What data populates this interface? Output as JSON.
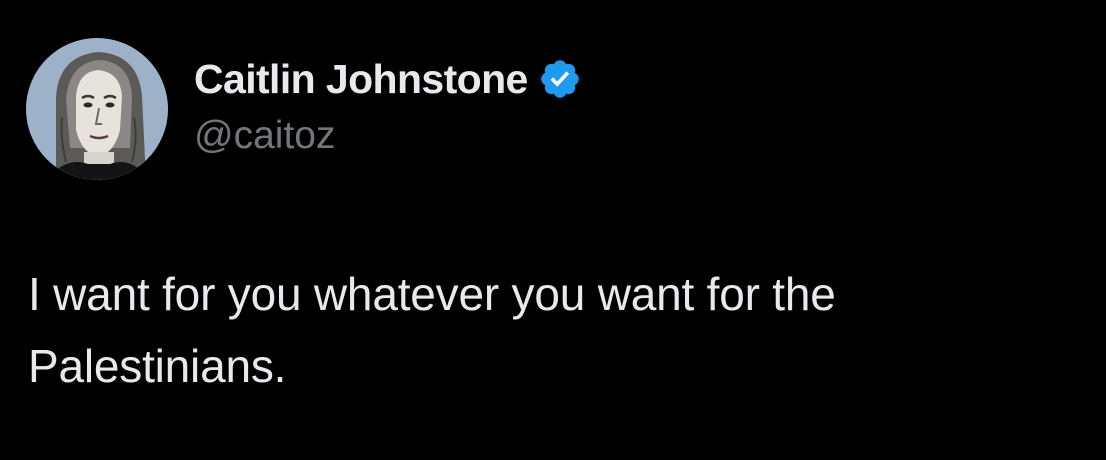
{
  "author": {
    "display_name": "Caitlin Johnstone",
    "handle": "@caitoz",
    "verified": true,
    "avatar_icon": "profile-avatar",
    "verified_icon": "verified-badge-icon"
  },
  "tweet": {
    "text_lines": [
      "I want for you whatever you want for the",
      "Palestinians."
    ]
  },
  "colors": {
    "background": "#000000",
    "primary_text": "#e7e9ea",
    "secondary_text": "#71767b",
    "verified_blue": "#1d9bf0"
  }
}
